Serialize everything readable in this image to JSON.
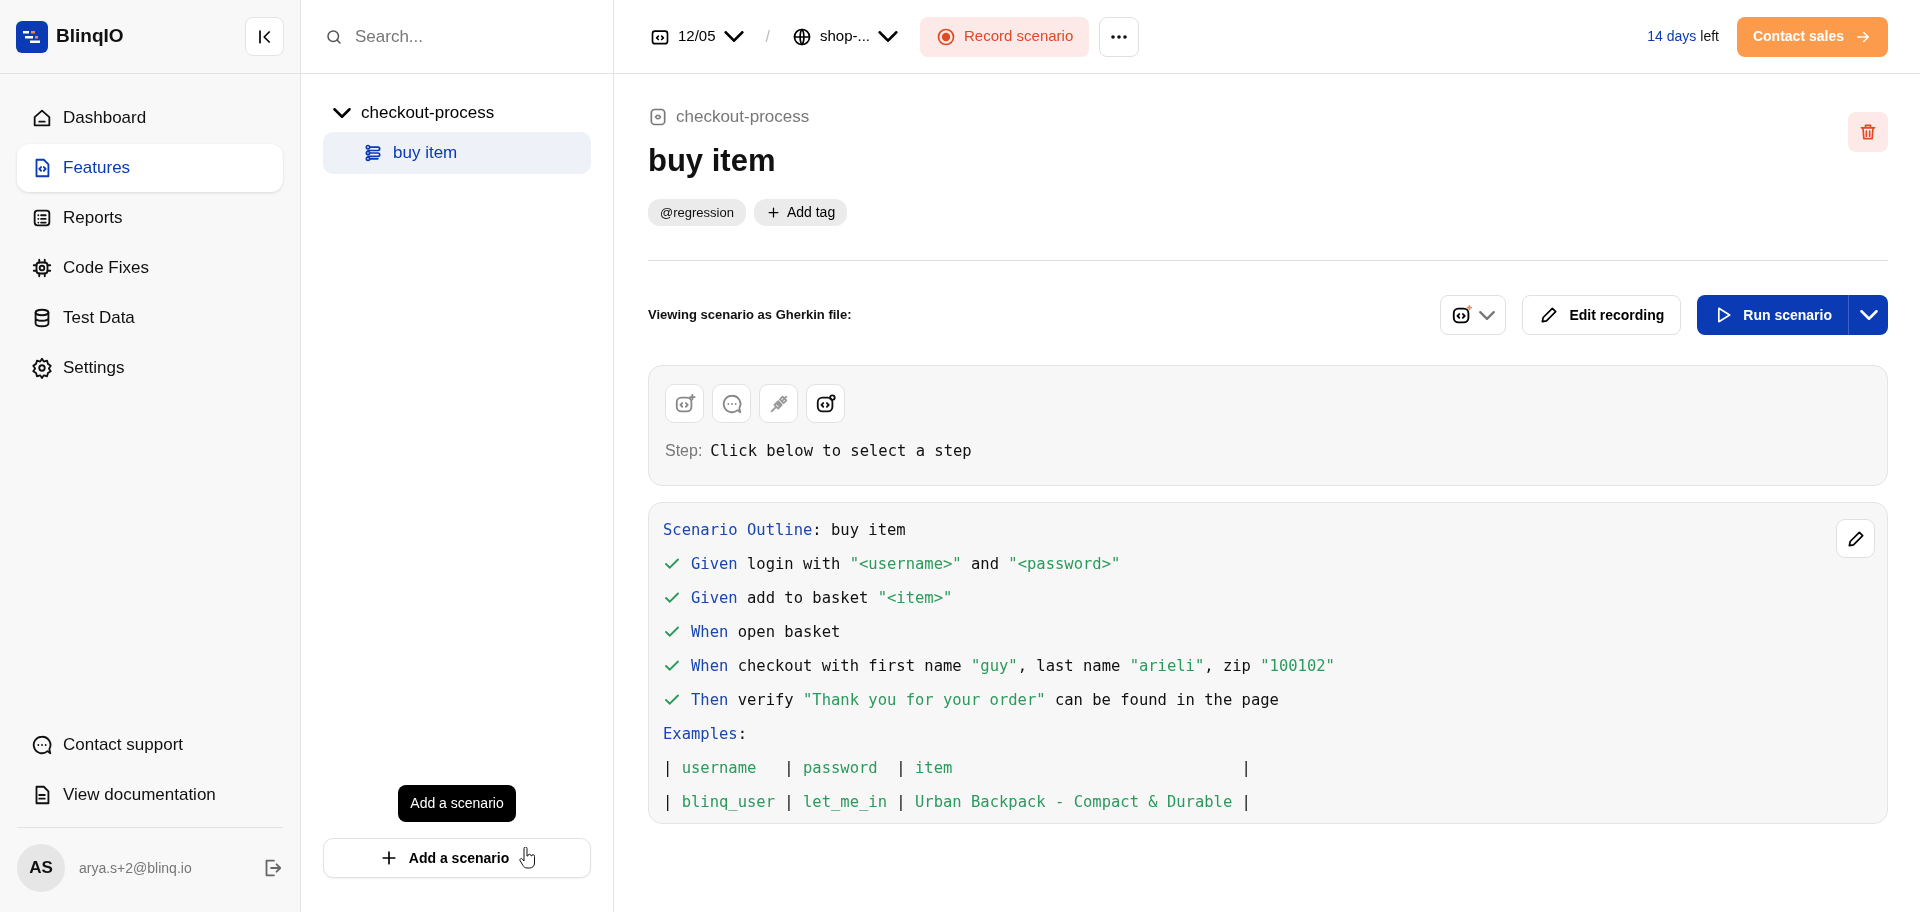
{
  "brand": {
    "name": "BlinqIO"
  },
  "nav": [
    {
      "label": "Dashboard",
      "selected": false
    },
    {
      "label": "Features",
      "selected": true
    },
    {
      "label": "Reports",
      "selected": false
    },
    {
      "label": "Code Fixes",
      "selected": false
    },
    {
      "label": "Test Data",
      "selected": false
    },
    {
      "label": "Settings",
      "selected": false
    }
  ],
  "support_links": [
    {
      "label": "Contact support"
    },
    {
      "label": "View documentation"
    }
  ],
  "user": {
    "initials": "AS",
    "email": "arya.s+2@blinq.io"
  },
  "search": {
    "placeholder": "Search..."
  },
  "tree": [
    {
      "label": "checkout-process",
      "expanded": true,
      "children": [
        {
          "label": "buy item",
          "selected": true
        }
      ]
    }
  ],
  "tooltip": "Add a scenario",
  "add_scenario_button": "Add a scenario",
  "topbar": {
    "version": "12/05",
    "separator": "/",
    "site": "shop-...",
    "record_button": "Record scenario",
    "trial_days": "14 days",
    "trial_suffix": "left",
    "contact_button": "Contact sales"
  },
  "header": {
    "feature": "checkout-process",
    "title": "buy item",
    "tags": [
      "@regression"
    ],
    "add_tag": "Add tag"
  },
  "view_label": "Viewing scenario as Gherkin file:",
  "actions": {
    "edit": "Edit recording",
    "run": "Run scenario"
  },
  "step": {
    "label": "Step:",
    "text": "Click below to select a step"
  },
  "gherkin": [
    {
      "kind": "heading",
      "tokens": [
        {
          "kind": "keyword",
          "text": "Scenario Outline"
        },
        {
          "kind": "plain",
          "text": ": buy item"
        }
      ]
    },
    {
      "kind": "step",
      "checked": true,
      "tokens": [
        {
          "kind": "keyword",
          "text": "Given"
        },
        {
          "kind": "plain",
          "text": " login with "
        },
        {
          "kind": "string",
          "text": "\"<username>\""
        },
        {
          "kind": "plain",
          "text": " and "
        },
        {
          "kind": "string",
          "text": "\"<password>\""
        }
      ]
    },
    {
      "kind": "step",
      "checked": true,
      "tokens": [
        {
          "kind": "keyword",
          "text": "Given"
        },
        {
          "kind": "plain",
          "text": " add to basket "
        },
        {
          "kind": "string",
          "text": "\"<item>\""
        }
      ]
    },
    {
      "kind": "step",
      "checked": true,
      "tokens": [
        {
          "kind": "keyword",
          "text": "When"
        },
        {
          "kind": "plain",
          "text": " open basket"
        }
      ]
    },
    {
      "kind": "step",
      "checked": true,
      "tokens": [
        {
          "kind": "keyword",
          "text": "When"
        },
        {
          "kind": "plain",
          "text": " checkout with first name "
        },
        {
          "kind": "string",
          "text": "\"guy\""
        },
        {
          "kind": "plain",
          "text": ", last name "
        },
        {
          "kind": "string",
          "text": "\"arieli\""
        },
        {
          "kind": "plain",
          "text": ", zip "
        },
        {
          "kind": "string",
          "text": "\"100102\""
        }
      ]
    },
    {
      "kind": "step",
      "checked": true,
      "tokens": [
        {
          "kind": "keyword",
          "text": "Then"
        },
        {
          "kind": "plain",
          "text": " verify "
        },
        {
          "kind": "string",
          "text": "\"Thank you for your order\""
        },
        {
          "kind": "plain",
          "text": " can be found in the page"
        }
      ]
    },
    {
      "kind": "heading",
      "tokens": [
        {
          "kind": "keyword",
          "text": "Examples"
        },
        {
          "kind": "plain",
          "text": ":"
        }
      ]
    },
    {
      "kind": "heading",
      "tokens": [
        {
          "kind": "plain",
          "text": "| "
        },
        {
          "kind": "string",
          "text": "username"
        },
        {
          "kind": "plain",
          "text": "   | "
        },
        {
          "kind": "string",
          "text": "password"
        },
        {
          "kind": "plain",
          "text": "  | "
        },
        {
          "kind": "string",
          "text": "item"
        },
        {
          "kind": "plain",
          "text": "                               |"
        }
      ]
    },
    {
      "kind": "heading",
      "tokens": [
        {
          "kind": "plain",
          "text": "| "
        },
        {
          "kind": "string",
          "text": "blinq_user"
        },
        {
          "kind": "plain",
          "text": " | "
        },
        {
          "kind": "string",
          "text": "let_me_in"
        },
        {
          "kind": "plain",
          "text": " | "
        },
        {
          "kind": "string",
          "text": "Urban Backpack - Compact & Durable"
        },
        {
          "kind": "plain",
          "text": " |"
        }
      ]
    }
  ]
}
